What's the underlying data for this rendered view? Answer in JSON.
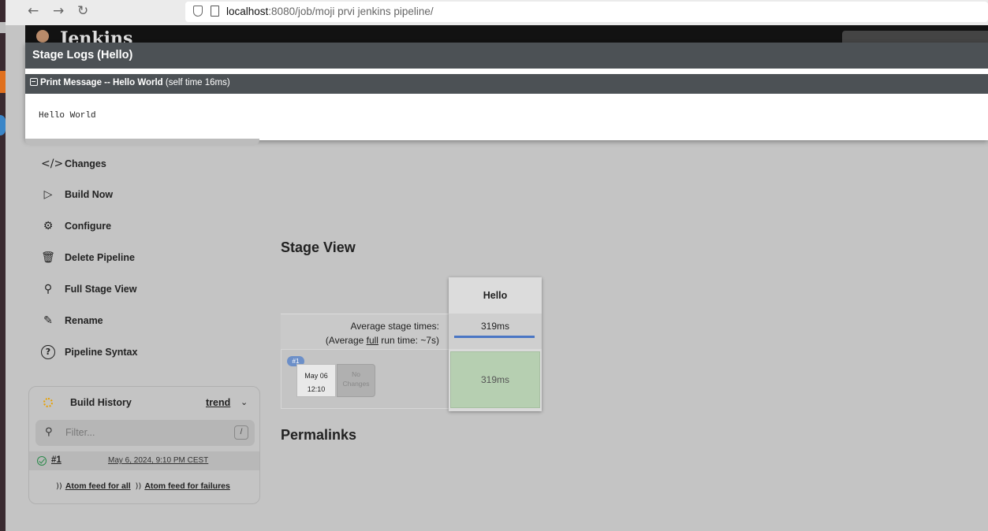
{
  "browser": {
    "url_host": "localhost",
    "url_rest": ":8080/job/moji prvi jenkins pipeline/"
  },
  "header": {
    "app_title": "Jenkins"
  },
  "stage_logs": {
    "title": "Stage Logs (Hello)",
    "step_name": "Print Message -- Hello World",
    "step_time": "(self time 16ms)",
    "log_output": "Hello World"
  },
  "sidebar": {
    "items": [
      {
        "label": "Changes",
        "icon": "code-icon"
      },
      {
        "label": "Build Now",
        "icon": "play-icon"
      },
      {
        "label": "Configure",
        "icon": "gear-icon"
      },
      {
        "label": "Delete Pipeline",
        "icon": "trash-icon"
      },
      {
        "label": "Full Stage View",
        "icon": "search-icon"
      },
      {
        "label": "Rename",
        "icon": "pencil-icon"
      },
      {
        "label": "Pipeline Syntax",
        "icon": "help-icon"
      }
    ]
  },
  "build_history": {
    "title": "Build History",
    "trend_label": "trend",
    "filter_placeholder": "Filter...",
    "filter_shortcut": "/",
    "builds": [
      {
        "number": "#1",
        "date": "May 6, 2024, 9:10 PM CEST",
        "status": "success"
      }
    ],
    "feed_all": "Atom feed for all",
    "feed_failures": "Atom feed for failures"
  },
  "stage_view": {
    "title": "Stage View",
    "stage_name": "Hello",
    "avg_label": "Average stage times:",
    "avg_full_prefix": "(Average ",
    "avg_full_word": "full",
    "avg_full_suffix": " run time: ~7s)",
    "avg_stage_time": "319ms",
    "runs": [
      {
        "badge": "#1",
        "date": "May 06",
        "time": "12:10",
        "changes_line1": "No",
        "changes_line2": "Changes",
        "stage_time": "319ms"
      }
    ]
  },
  "permalinks": {
    "title": "Permalinks"
  }
}
